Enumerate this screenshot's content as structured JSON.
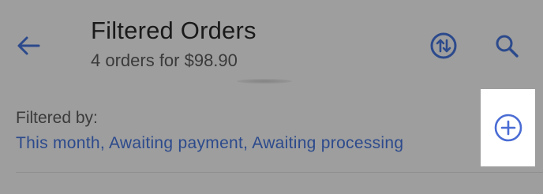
{
  "app_bar": {
    "title": "Filtered Orders",
    "subtitle": "4 orders for $98.90",
    "icons": {
      "back": "arrow-back-icon",
      "sort": "swap-vertical-icon",
      "search": "search-icon"
    }
  },
  "filters": {
    "label": "Filtered by:",
    "values": "This month, Awaiting payment, Awaiting processing",
    "add_icon": "add-circle-icon"
  },
  "colors": {
    "accent": "#2c4a8c",
    "accent_highlight": "#4a6cd4",
    "dim_background": "#9e9e9e",
    "highlight_background": "#ffffff"
  }
}
